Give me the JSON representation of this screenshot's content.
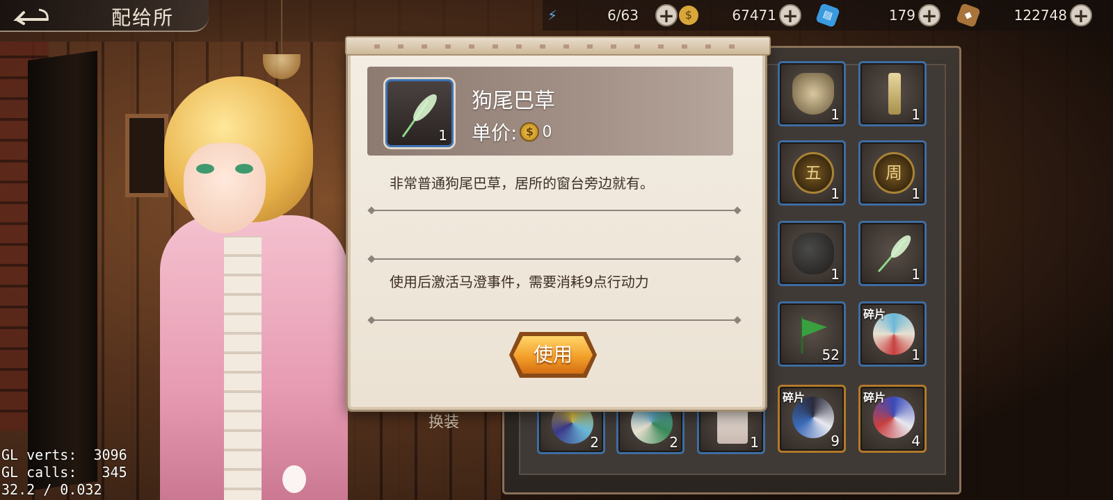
{
  "top_bar": {
    "back_icon": "back-arrow-icon",
    "title": "配给所",
    "resources": [
      {
        "icon": "lightning-icon",
        "value": "6/63",
        "color": "#5aa8e8"
      },
      {
        "icon": "gold-coin-icon",
        "value": "67471",
        "color": "#e0b040"
      },
      {
        "icon": "blue-ticket-icon",
        "value": "179",
        "color": "#3a9ae0"
      },
      {
        "icon": "bronze-token-icon",
        "value": "122748",
        "color": "#c0904a"
      }
    ],
    "plus_label": "+"
  },
  "inventory": {
    "slots": [
      {
        "count": "1",
        "tag": "",
        "art": "food-plate-icon"
      },
      {
        "count": "1",
        "tag": "",
        "art": "candle-icon"
      },
      {
        "count": "1",
        "tag": "",
        "art": "coin-wu-icon",
        "glyph": "五"
      },
      {
        "count": "1",
        "tag": "",
        "art": "coin-zhou-icon",
        "glyph": "周"
      },
      {
        "count": "1",
        "tag": "",
        "art": "money-bag-icon"
      },
      {
        "count": "1",
        "tag": "",
        "art": "foxtail-grass-icon"
      },
      {
        "count": "52",
        "tag": "",
        "art": "green-flag-icon"
      },
      {
        "count": "1",
        "tag": "碎片",
        "art": "fragment-icon"
      },
      {
        "count": "2",
        "tag": "",
        "art": "fragment-icon"
      },
      {
        "count": "2",
        "tag": "",
        "art": "fragment-icon"
      },
      {
        "count": "1",
        "tag": "",
        "art": "card-icon"
      },
      {
        "count": "9",
        "tag": "碎片",
        "art": "fragment-icon"
      },
      {
        "count": "4",
        "tag": "碎片",
        "art": "fragment-icon"
      }
    ],
    "swap_label": "换装"
  },
  "dialog": {
    "item_name": "狗尾巴草",
    "item_count": "1",
    "price_label": "单价:",
    "price_value": "0",
    "description": "非常普通狗尾巴草，居所的窗台旁边就有。",
    "effect": "使用后激活马澄事件，需要消耗9点行动力",
    "use_button": "使用"
  },
  "debug": {
    "line1": "GL verts:  3096",
    "line2": "GL calls:   345",
    "line3": "32.2 / 0.032"
  }
}
